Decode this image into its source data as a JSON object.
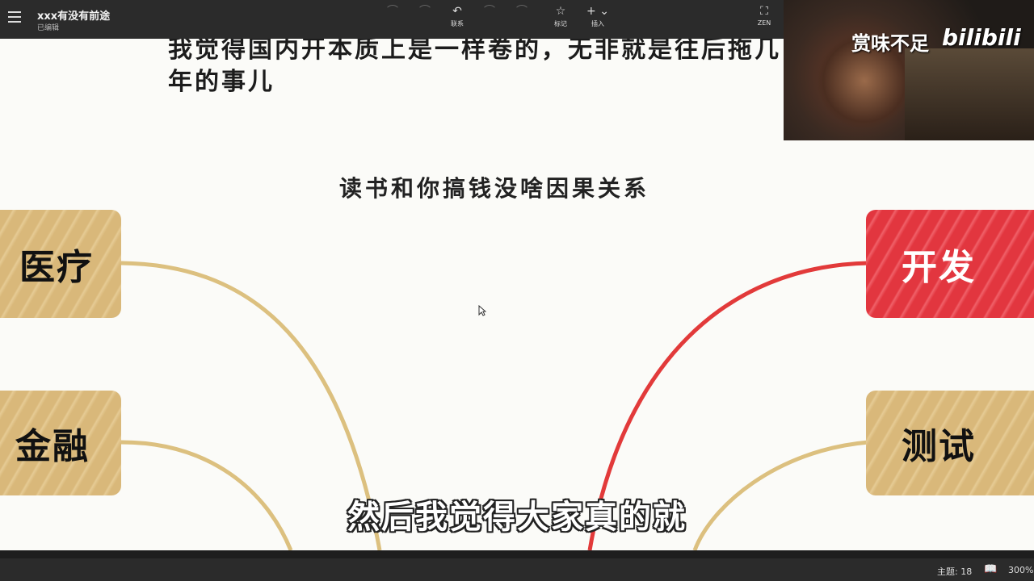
{
  "app": {
    "doc_title": "xxx有没有前途",
    "doc_status": "已编辑"
  },
  "toolbar": {
    "tools": [
      {
        "icon": "undo-icon",
        "glyph": "⌒",
        "label": "",
        "faint": true
      },
      {
        "icon": "redo-icon",
        "glyph": "⌒",
        "label": "",
        "faint": true
      },
      {
        "icon": "link-icon",
        "glyph": "↶",
        "label": "联系",
        "faint": false
      },
      {
        "icon": "summary-icon",
        "glyph": "⌒",
        "label": "",
        "faint": true
      },
      {
        "icon": "outline-icon",
        "glyph": "⌒",
        "label": "",
        "faint": true
      },
      {
        "icon": "star-icon",
        "glyph": "☆",
        "label": "标记",
        "faint": false
      },
      {
        "icon": "plus-icon",
        "glyph": "+ ⌄",
        "label": "插入",
        "faint": false
      },
      {
        "icon": "zen-icon",
        "glyph": "⛶",
        "label": "ZEN",
        "faint": false
      }
    ]
  },
  "content": {
    "para_line1": "我觉得国内开本质上是一样卷的，无非就是往后拖几",
    "para_line2": "年的事儿",
    "center_topic": "读书和你搞钱没啥因果关系",
    "nodes": {
      "medical": "医疗",
      "finance": "金融",
      "dev": "开发",
      "test": "测试"
    },
    "colors": {
      "gold": "#d9b87a",
      "red": "#e2363f",
      "line_gold": "#dcc07f",
      "line_red": "#e23a3a"
    }
  },
  "subtitle": "然后我觉得大家真的就",
  "video": {
    "caption": "赏味不足",
    "logo": "bilibili"
  },
  "statusbar": {
    "word_count": "主题: 18",
    "book_icon": "📖",
    "zoom": "300%"
  }
}
